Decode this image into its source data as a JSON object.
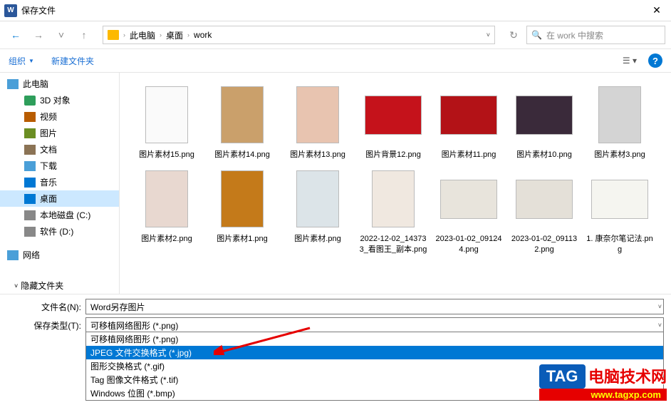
{
  "window": {
    "title": "保存文件"
  },
  "nav": {
    "crumbs": [
      "此电脑",
      "桌面",
      "work"
    ],
    "search_placeholder": "在 work 中搜索",
    "refresh": "↻"
  },
  "toolbar": {
    "organize": "组织",
    "newfolder": "新建文件夹"
  },
  "sidebar": {
    "items": [
      {
        "label": "此电脑",
        "icon": "ic-pc"
      },
      {
        "label": "3D 对象",
        "icon": "ic-3d"
      },
      {
        "label": "视频",
        "icon": "ic-video"
      },
      {
        "label": "图片",
        "icon": "ic-img"
      },
      {
        "label": "文档",
        "icon": "ic-doc"
      },
      {
        "label": "下载",
        "icon": "ic-dl"
      },
      {
        "label": "音乐",
        "icon": "ic-music"
      },
      {
        "label": "桌面",
        "icon": "ic-desk",
        "selected": true
      },
      {
        "label": "本地磁盘 (C:)",
        "icon": "ic-disk"
      },
      {
        "label": "软件 (D:)",
        "icon": "ic-disk"
      },
      {
        "label": "网络",
        "icon": "ic-net"
      }
    ]
  },
  "files": [
    {
      "name": "图片素材15.png",
      "shape": "tall",
      "bg": "#fafafa"
    },
    {
      "name": "图片素材14.png",
      "shape": "tall",
      "bg": "#caa06b"
    },
    {
      "name": "图片素材13.png",
      "shape": "tall",
      "bg": "#e8c4b0"
    },
    {
      "name": "图片背景12.png",
      "shape": "wide",
      "bg": "#c5121b"
    },
    {
      "name": "图片素材11.png",
      "shape": "wide",
      "bg": "#b31217"
    },
    {
      "name": "图片素材10.png",
      "shape": "wide",
      "bg": "#3a2a3a"
    },
    {
      "name": "图片素材3.png",
      "shape": "tall",
      "bg": "#d4d4d4"
    },
    {
      "name": "图片素材2.png",
      "shape": "tall",
      "bg": "#e8d8d0"
    },
    {
      "name": "图片素材1.png",
      "shape": "tall",
      "bg": "#c47a1a"
    },
    {
      "name": "图片素材.png",
      "shape": "tall",
      "bg": "#dce4e8"
    },
    {
      "name": "2022-12-02_143733_看图王_副本.png",
      "shape": "tall",
      "bg": "#f0e8e0"
    },
    {
      "name": "2023-01-02_091244.png",
      "shape": "wide",
      "bg": "#e8e4dc"
    },
    {
      "name": "2023-01-02_091132.png",
      "shape": "wide",
      "bg": "#e4e0d8"
    },
    {
      "name": "1. 康奈尔笔记法.png",
      "shape": "wide",
      "bg": "#f5f5f0"
    }
  ],
  "form": {
    "filename_label": "文件名(N):",
    "filename_value": "Word另存图片",
    "filetype_label": "保存类型(T):",
    "filetype_value": "可移植网络图形 (*.png)",
    "options": [
      "可移植网络图形 (*.png)",
      "JPEG 文件交换格式 (*.jpg)",
      "图形交换格式 (*.gif)",
      "Tag 图像文件格式 (*.tif)",
      "Windows 位图 (*.bmp)"
    ],
    "selected_index": 1,
    "hide_folders": "隐藏文件夹"
  },
  "watermark": {
    "tag": "TAG",
    "text": "电脑技术网",
    "url": "www.tagxp.com"
  }
}
